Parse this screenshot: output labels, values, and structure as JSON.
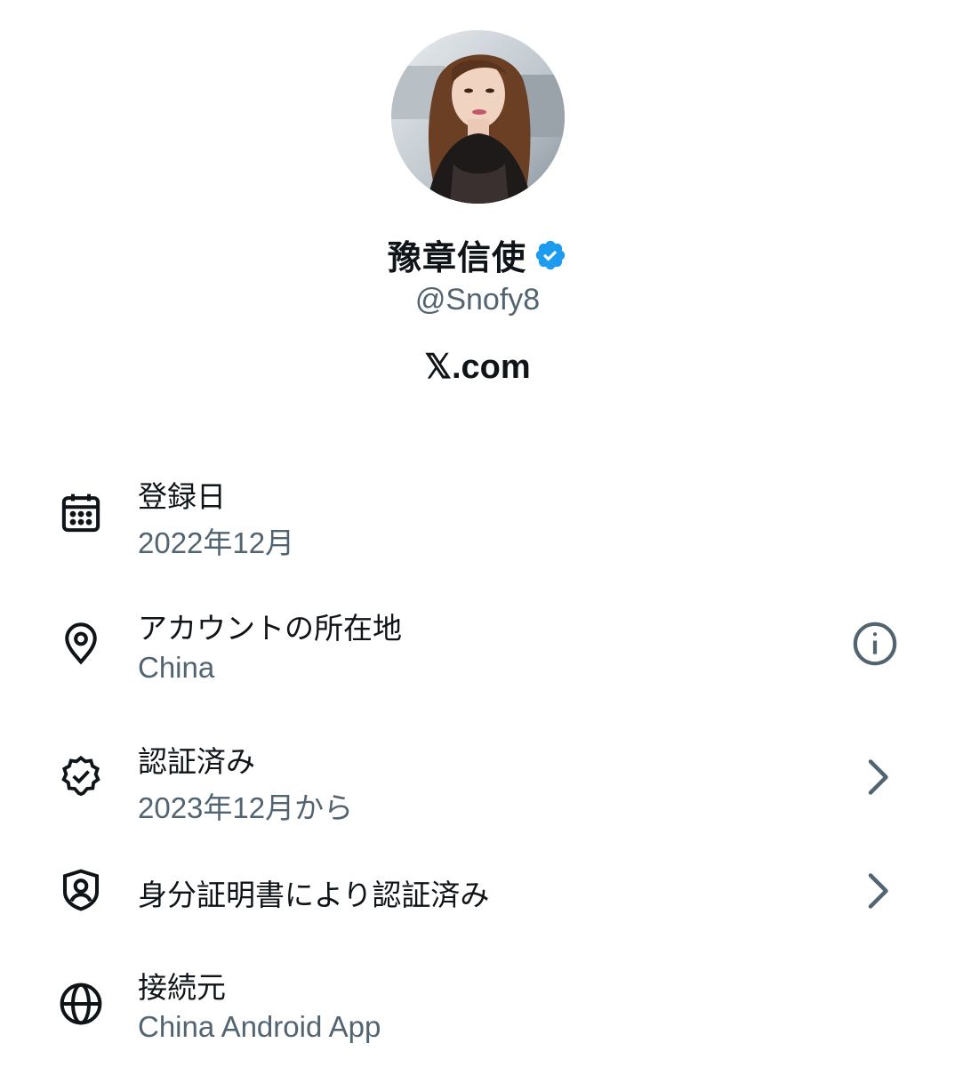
{
  "profile": {
    "display_name": "豫章信使",
    "verified_icon": "verified-badge-icon",
    "handle": "@Snofy8",
    "site": "𝕏.com",
    "colors": {
      "verified_blue": "#1d9bf0",
      "primary_text": "#0f1419",
      "secondary_text": "#536471"
    }
  },
  "about": {
    "items": [
      {
        "icon": "calendar-icon",
        "label": "登録日",
        "value": "2022年12月"
      },
      {
        "icon": "location-pin-icon",
        "label": "アカウントの所在地",
        "value": "China",
        "trailing": "info-icon"
      },
      {
        "icon": "verified-check-icon",
        "label": "認証済み",
        "value": "2023年12月から",
        "trailing": "chevron-right-icon"
      },
      {
        "icon": "id-shield-icon",
        "label": "身分証明書により認証済み",
        "trailing": "chevron-right-icon"
      },
      {
        "icon": "globe-icon",
        "label": "接続元",
        "value": "China Android App"
      }
    ]
  }
}
